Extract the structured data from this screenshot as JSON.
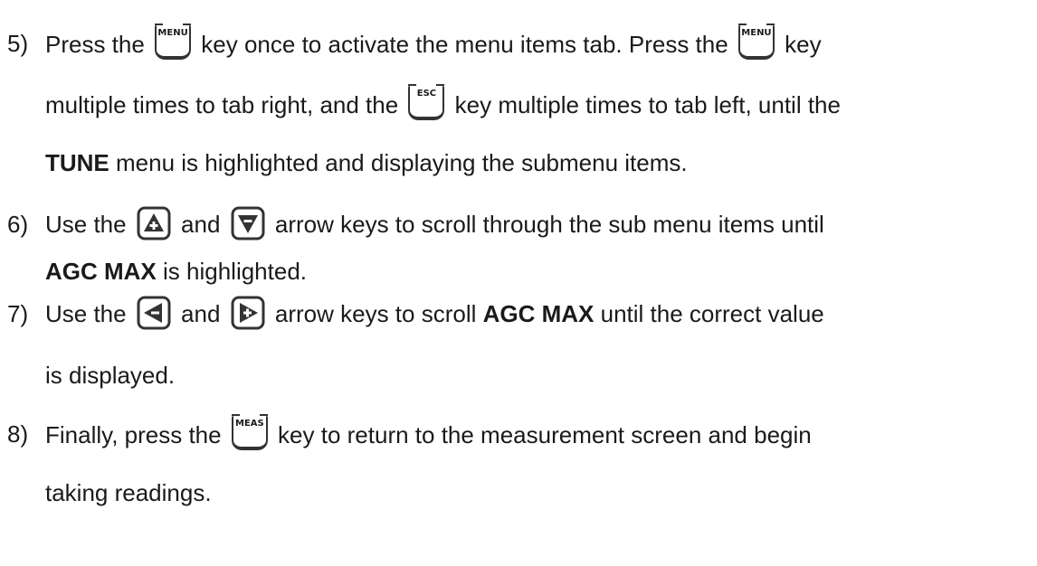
{
  "steps": [
    {
      "number": "5)",
      "lines": [
        [
          "Press the ",
          {
            "key": "MENU",
            "icon": "menu-key-icon"
          },
          " key once to activate the menu items tab.  Press the ",
          {
            "key": "MENU",
            "icon": "menu-key-icon"
          },
          " key"
        ],
        [
          "multiple times to tab right, and the ",
          {
            "key": "ESC",
            "icon": "esc-key-icon"
          },
          " key multiple times to tab left, until the"
        ],
        [
          {
            "b": "TUNE"
          },
          " menu is highlighted and displaying the submenu items."
        ]
      ]
    },
    {
      "number": "6)",
      "lines": [
        [
          "Use the ",
          {
            "arrow": "up",
            "icon": "up-arrow-key-icon"
          },
          " and ",
          {
            "arrow": "down",
            "icon": "down-arrow-key-icon"
          },
          " arrow keys to scroll through the sub menu items until"
        ],
        [
          {
            "b": "AGC MAX"
          },
          " is highlighted."
        ]
      ]
    },
    {
      "number": "7)",
      "lines": [
        [
          "Use the ",
          {
            "arrow": "left",
            "icon": "left-arrow-key-icon"
          },
          " and ",
          {
            "arrow": "right",
            "icon": "right-arrow-key-icon"
          },
          "  arrow keys to scroll ",
          {
            "b": "AGC MAX"
          },
          " until the correct value"
        ],
        [
          "is displayed."
        ]
      ]
    },
    {
      "number": "8)",
      "lines": [
        [
          "Finally, press the ",
          {
            "key": "MEAS",
            "icon": "meas-key-icon"
          },
          " key to return to the measurement screen and begin"
        ],
        [
          "taking readings."
        ]
      ]
    }
  ]
}
